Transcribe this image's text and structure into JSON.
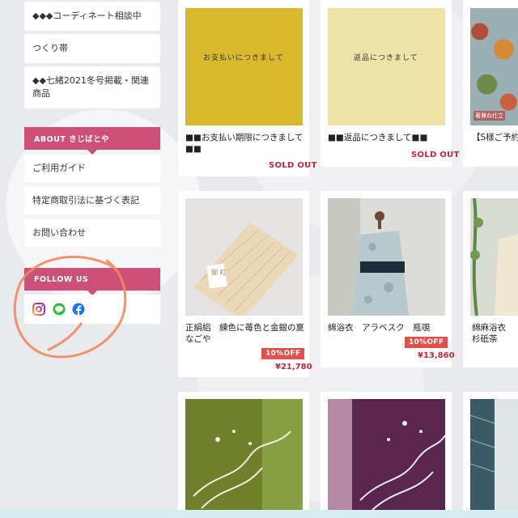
{
  "sidebar": {
    "items_top": [
      {
        "label": "◆◆◆コーディネート相談中"
      },
      {
        "label": "つくり帯"
      },
      {
        "label": "◆◆七緒2021冬号掲載・関連商品"
      }
    ],
    "about_heading": "ABOUT きじばとや",
    "about_items": [
      {
        "label": "ご利用ガイド"
      },
      {
        "label": "特定商取引法に基づく表記"
      },
      {
        "label": "お問い合わせ"
      }
    ],
    "follow_heading": "FOLLOW US",
    "sns": [
      "instagram-icon",
      "line-icon",
      "facebook-icon"
    ]
  },
  "products": [
    {
      "name": "■■お支払い期限につきまして■■",
      "thumb_text": "お支払いにつきまして",
      "status": "SOLD OUT"
    },
    {
      "name": "■■返品につきまして■■",
      "thumb_text": "返品につきまして",
      "status": "SOLD OUT"
    },
    {
      "name": "【S様ご予約製うそつき袖",
      "thumb_badge": "著兼ね仕立"
    },
    {
      "name": "正絹絽　練色に苺色と金銀の夏なごや",
      "discount": "10%OFF",
      "price": "¥21,780",
      "thumb_label": "御 紅"
    },
    {
      "name": "綿浴衣　アラベスク　瓶覗",
      "discount": "10%OFF",
      "price": "¥13,860"
    },
    {
      "name": "綿麻浴衣　杉砥茶"
    }
  ],
  "colors": {
    "accent": "#cd5078",
    "sold": "#c0283c",
    "discount": "#e2504a",
    "mustard": "#d8b92e",
    "cream": "#ede3a6"
  }
}
